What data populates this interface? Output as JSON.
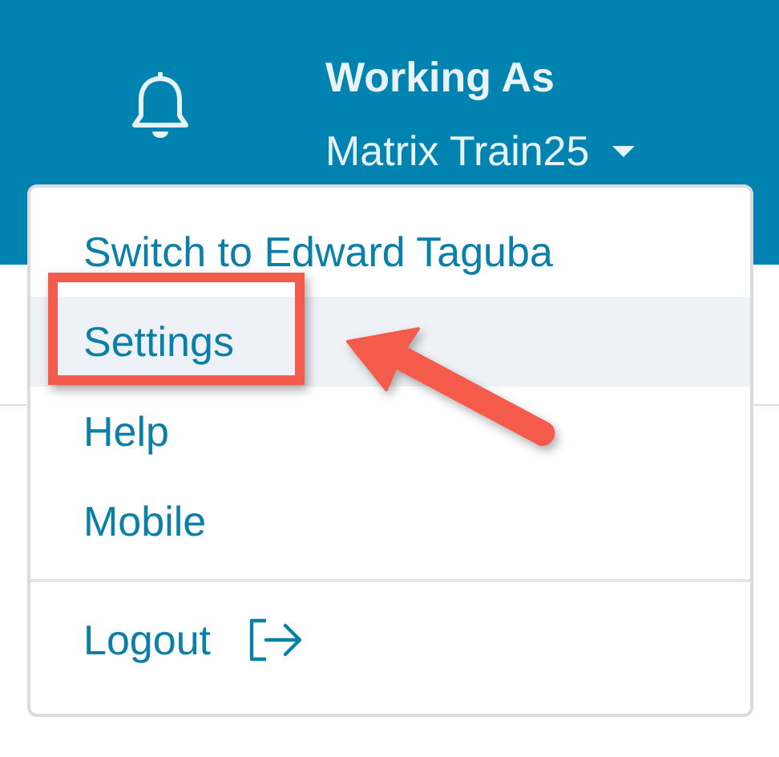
{
  "header": {
    "label": "Working As",
    "user": "Matrix Train25"
  },
  "menu": {
    "items": [
      {
        "label": "Switch to Edward Taguba",
        "kind": "link",
        "hovered": false,
        "annotated": false
      },
      {
        "label": "Settings",
        "kind": "link",
        "hovered": true,
        "annotated": true
      },
      {
        "label": "Help",
        "kind": "link",
        "hovered": false,
        "annotated": false
      },
      {
        "label": "Mobile",
        "kind": "link",
        "hovered": false,
        "annotated": false
      },
      {
        "label": "Logout",
        "kind": "logout",
        "hovered": false,
        "annotated": false
      }
    ]
  }
}
